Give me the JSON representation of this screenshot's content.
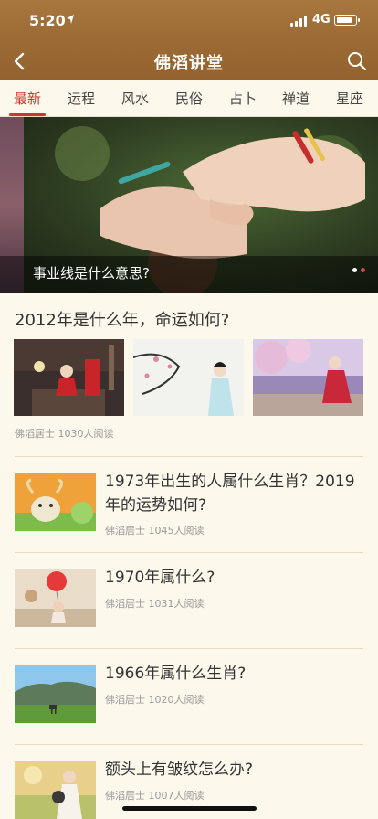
{
  "status_bar": {
    "time": "5:20",
    "network": "4G"
  },
  "header": {
    "title": "佛滔讲堂"
  },
  "tabs": [
    "最新",
    "运程",
    "风水",
    "民俗",
    "占卜",
    "禅道",
    "星座"
  ],
  "banner": {
    "caption": "事业线是什么意思?"
  },
  "featured": {
    "title": "2012年是什么年，命运如何?",
    "meta": "佛滔居士 1030人阅读"
  },
  "articles": [
    {
      "title": "1973年出生的人属什么生肖？2019年的运势如何?",
      "meta": "佛滔居士 1045人阅读"
    },
    {
      "title": "1970年属什么?",
      "meta": "佛滔居士 1031人阅读"
    },
    {
      "title": "1966年属什么生肖?",
      "meta": "佛滔居士 1020人阅读"
    },
    {
      "title": "额头上有皱纹怎么办?",
      "meta": "佛滔居士 1007人阅读"
    }
  ],
  "colors": {
    "header": "#9c6a34",
    "accent": "#c53a2f",
    "background": "#fdf8ec"
  },
  "icons": [
    "location-arrow-icon",
    "signal-icon",
    "battery-icon",
    "back-chevron-icon",
    "search-icon"
  ]
}
